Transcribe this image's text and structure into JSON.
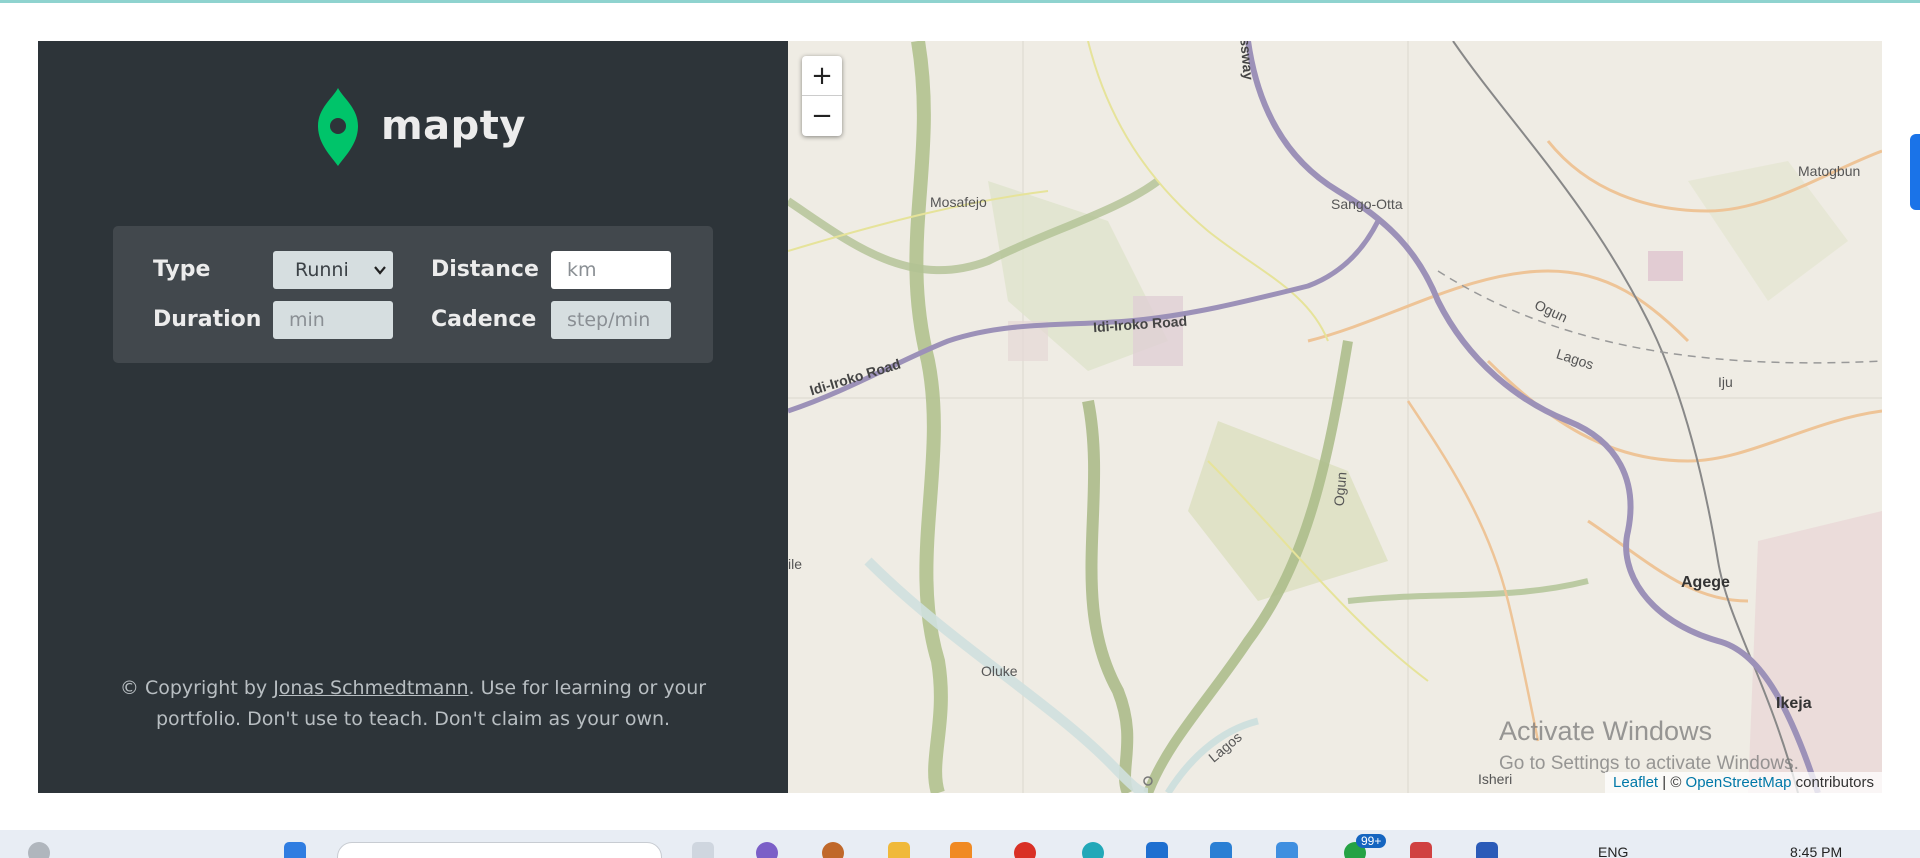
{
  "app": {
    "logo_text": "mapty"
  },
  "form": {
    "type_label": "Type",
    "type_value": "Runni",
    "distance_label": "Distance",
    "distance_placeholder": "km",
    "duration_label": "Duration",
    "duration_placeholder": "min",
    "cadence_label": "Cadence",
    "cadence_placeholder": "step/min"
  },
  "footer": {
    "prefix": "© Copyright by ",
    "author": "Jonas Schmedtmann",
    "suffix": ". Use for learning or your",
    "line2": "portfolio. Don't use to teach. Don't claim as your own."
  },
  "map": {
    "zoom_in": "+",
    "zoom_out": "−",
    "attribution_leaflet": "Leaflet",
    "attribution_sep": " | © ",
    "attribution_osm": "OpenStreetMap",
    "attribution_suffix": " contributors",
    "labels": {
      "mosafejo": "Mosafejo",
      "sango_otta": "Sango-Otta",
      "matogbun": "Matogbun",
      "idi_iroko_1": "Idi-Iroko Road",
      "idi_iroko_2": "Idi-Iroko Road",
      "ogun_1": "Ogun",
      "lagos_1": "Lagos",
      "iju": "Iju",
      "ogun_river": "Ogun",
      "agege": "Agege",
      "oluke": "Oluke",
      "ikeja": "Ikeja",
      "lagos_2": "Lagos",
      "isheri": "Isheri",
      "expressway": "ssway",
      "left_edge": "ile"
    },
    "watermark_line1": "Activate Windows",
    "watermark_line2": "Go to Settings to activate Windows."
  },
  "taskbar": {
    "language": "ENG",
    "time": "8:45 PM",
    "badge": "99+"
  },
  "colors": {
    "sidebar_bg": "#2d3439",
    "form_bg": "#42484d",
    "brand_green": "#00c46a",
    "map_bg": "#efece4",
    "road_purple": "#9c91b8"
  }
}
